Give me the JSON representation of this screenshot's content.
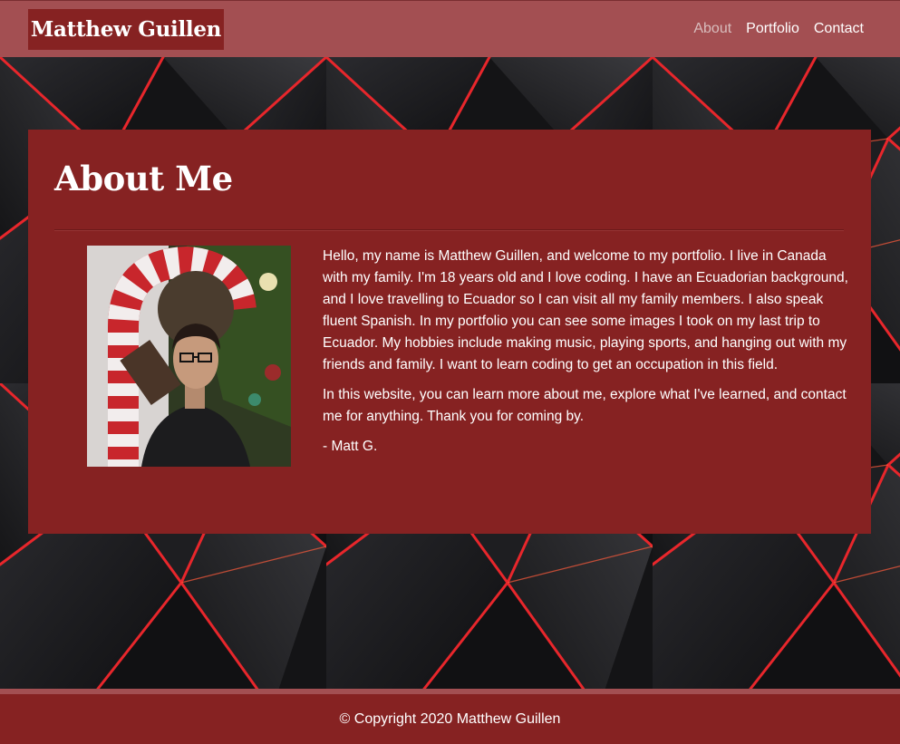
{
  "header": {
    "brand": "Matthew Guillen",
    "nav": [
      {
        "label": "About",
        "active": true
      },
      {
        "label": "Portfolio",
        "active": false
      },
      {
        "label": "Contact",
        "active": false
      }
    ]
  },
  "about": {
    "title": "About Me",
    "paragraphs": [
      "Hello, my name is Matthew Guillen, and welcome to my portfolio. I live in Canada with my family. I'm 18 years old and I love coding. I have an Ecuadorian background, and I love travelling to Ecuador so I can visit all my family members. I also speak fluent Spanish. In my portfolio you can see some images I took on my last trip to Ecuador. My hobbies include making music, playing sports, and hanging out with my friends and family. I want to learn coding to get an occupation in this field.",
      "In this website, you can learn more about me, explore what I've learned, and contact me for anything. Thank you for coming by.",
      "- Matt G."
    ]
  },
  "footer": {
    "copyright": "© Copyright 2020 Matthew Guillen"
  },
  "colors": {
    "header_bg": "#a34f52",
    "card_bg": "#862222",
    "accent_red": "#e8262b"
  }
}
